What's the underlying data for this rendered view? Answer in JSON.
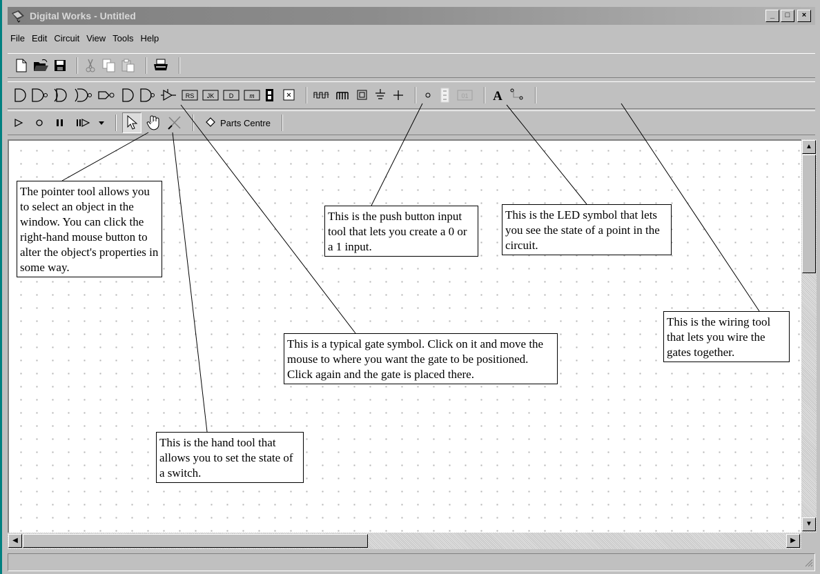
{
  "window": {
    "title": "Digital Works - Untitled",
    "min_label": "_",
    "max_label": "□",
    "close_label": "×"
  },
  "menu": {
    "items": [
      "File",
      "Edit",
      "Circuit",
      "View",
      "Tools",
      "Help"
    ]
  },
  "toolbar_file": {
    "icons": [
      "new-document-icon",
      "open-folder-icon",
      "save-icon",
      "cut-icon",
      "copy-icon",
      "paste-icon",
      "print-icon"
    ]
  },
  "toolbar_gates": {
    "icons": [
      "and-gate-icon",
      "or-gate-icon",
      "nand-gate-icon",
      "nor-gate-icon",
      "xor-gate-icon",
      "buffer-gate-icon",
      "not-gate-icon",
      "tristate-icon",
      "rs-flipflop-icon",
      "jk-flipflop-icon",
      "d-flipflop-icon",
      "macro-icon",
      "seven-seg-icon",
      "clear-icon",
      "clock-icon",
      "pulse-icon",
      "push-button-icon",
      "ground-icon",
      "power-icon",
      "led-icon",
      "display-icon",
      "number-icon",
      "text-icon",
      "wiring-icon"
    ],
    "rs_label": "RS",
    "jk_label": "JK",
    "d_label": "D",
    "m_label": "m",
    "num_label": "01",
    "text_label": "A"
  },
  "toolbar_run": {
    "icons": [
      "play-icon",
      "stop-icon",
      "pause-icon",
      "step-icon",
      "dropdown-arrow-icon",
      "pointer-tool-icon",
      "hand-tool-icon",
      "wire-cutter-icon"
    ],
    "parts_centre_label": "Parts Centre"
  },
  "callouts": {
    "pointer_tool": "The pointer tool allows you to select an object in the window. You can click the right-hand mouse button to alter the object's properties in some way.",
    "push_button": "This is the push button input tool that lets you create a 0 or a 1 input.",
    "led": "This is the LED symbol that lets you see the state of a point in the circuit.",
    "wiring": "This is the wiring tool that lets you wire the gates together.",
    "gate": "This is a typical gate symbol. Click on it and move the mouse to where you want the gate to be positioned. Click again and the gate is placed there.",
    "hand_tool": "This is the hand tool that allows you to set the state of a switch."
  },
  "colors": {
    "title_bar": "#8c8c8c",
    "face": "#c0c0c0",
    "desktop_edge": "#008080"
  }
}
